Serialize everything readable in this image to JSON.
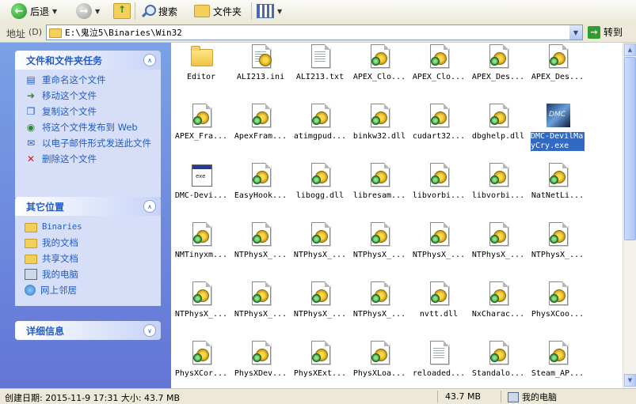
{
  "toolbar": {
    "back_label": "后退",
    "search_label": "搜索",
    "folders_label": "文件夹"
  },
  "address": {
    "label": "地址",
    "path": "E:\\鬼泣5\\Binaries\\Win32",
    "go_label": "转到"
  },
  "tasks_panel": {
    "title": "文件和文件夹任务",
    "items": [
      {
        "label": "重命名这个文件",
        "icon": "rename-icon"
      },
      {
        "label": "移动这个文件",
        "icon": "move-icon"
      },
      {
        "label": "复制这个文件",
        "icon": "copy-icon"
      },
      {
        "label": "将这个文件发布到 Web",
        "icon": "publish-web-icon"
      },
      {
        "label": "以电子邮件形式发送此文件",
        "icon": "email-icon"
      },
      {
        "label": "删除这个文件",
        "icon": "delete-icon"
      }
    ]
  },
  "places_panel": {
    "title": "其它位置",
    "items": [
      {
        "label": "Binaries",
        "icon": "folder-icon"
      },
      {
        "label": "我的文档",
        "icon": "folder-icon"
      },
      {
        "label": "共享文档",
        "icon": "folder-icon"
      },
      {
        "label": "我的电脑",
        "icon": "computer-icon"
      },
      {
        "label": "网上邻居",
        "icon": "network-icon"
      }
    ]
  },
  "details_panel": {
    "title": "详细信息"
  },
  "files": [
    {
      "label": "Editor",
      "type": "folder"
    },
    {
      "label": "ALI213.ini",
      "type": "ini"
    },
    {
      "label": "ALI213.txt",
      "type": "txt"
    },
    {
      "label": "APEX_Clo...",
      "type": "dll"
    },
    {
      "label": "APEX_Clo...",
      "type": "dll"
    },
    {
      "label": "APEX_Des...",
      "type": "dll"
    },
    {
      "label": "APEX_Des...",
      "type": "dll"
    },
    {
      "label": "APEX_Fra...",
      "type": "dll"
    },
    {
      "label": "ApexFram...",
      "type": "dll"
    },
    {
      "label": "atimgpud...",
      "type": "dll"
    },
    {
      "label": "binkw32.dll",
      "type": "dll"
    },
    {
      "label": "cudart32...",
      "type": "dll"
    },
    {
      "label": "dbghelp.dll",
      "type": "dll"
    },
    {
      "label": "DMC-DevilMayCry.exe",
      "type": "game",
      "selected": true
    },
    {
      "label": "DMC-Devi...",
      "type": "exe"
    },
    {
      "label": "EasyHook...",
      "type": "dll"
    },
    {
      "label": "libogg.dll",
      "type": "dll"
    },
    {
      "label": "libresam...",
      "type": "dll"
    },
    {
      "label": "libvorbi...",
      "type": "dll"
    },
    {
      "label": "libvorbi...",
      "type": "dll"
    },
    {
      "label": "NatNetLi...",
      "type": "dll"
    },
    {
      "label": "NMTinyxm...",
      "type": "dll"
    },
    {
      "label": "NTPhysX_...",
      "type": "dll"
    },
    {
      "label": "NTPhysX_...",
      "type": "dll"
    },
    {
      "label": "NTPhysX_...",
      "type": "dll"
    },
    {
      "label": "NTPhysX_...",
      "type": "dll"
    },
    {
      "label": "NTPhysX_...",
      "type": "dll"
    },
    {
      "label": "NTPhysX_...",
      "type": "dll"
    },
    {
      "label": "NTPhysX_...",
      "type": "dll"
    },
    {
      "label": "NTPhysX_...",
      "type": "dll"
    },
    {
      "label": "NTPhysX_...",
      "type": "dll"
    },
    {
      "label": "NTPhysX_...",
      "type": "dll"
    },
    {
      "label": "nvtt.dll",
      "type": "dll"
    },
    {
      "label": "NxCharac...",
      "type": "dll"
    },
    {
      "label": "PhysXCoo...",
      "type": "dll"
    },
    {
      "label": "PhysXCor...",
      "type": "dll"
    },
    {
      "label": "PhysXDev...",
      "type": "dll"
    },
    {
      "label": "PhysXExt...",
      "type": "dll"
    },
    {
      "label": "PhysXLoa...",
      "type": "dll"
    },
    {
      "label": "reloaded...",
      "type": "txt"
    },
    {
      "label": "Standalo...",
      "type": "dll"
    },
    {
      "label": "Steam_AP...",
      "type": "dll"
    }
  ],
  "status": {
    "details": "创建日期: 2015-11-9 17:31 大小: 43.7 MB",
    "size": "43.7 MB",
    "location": "我的电脑"
  }
}
